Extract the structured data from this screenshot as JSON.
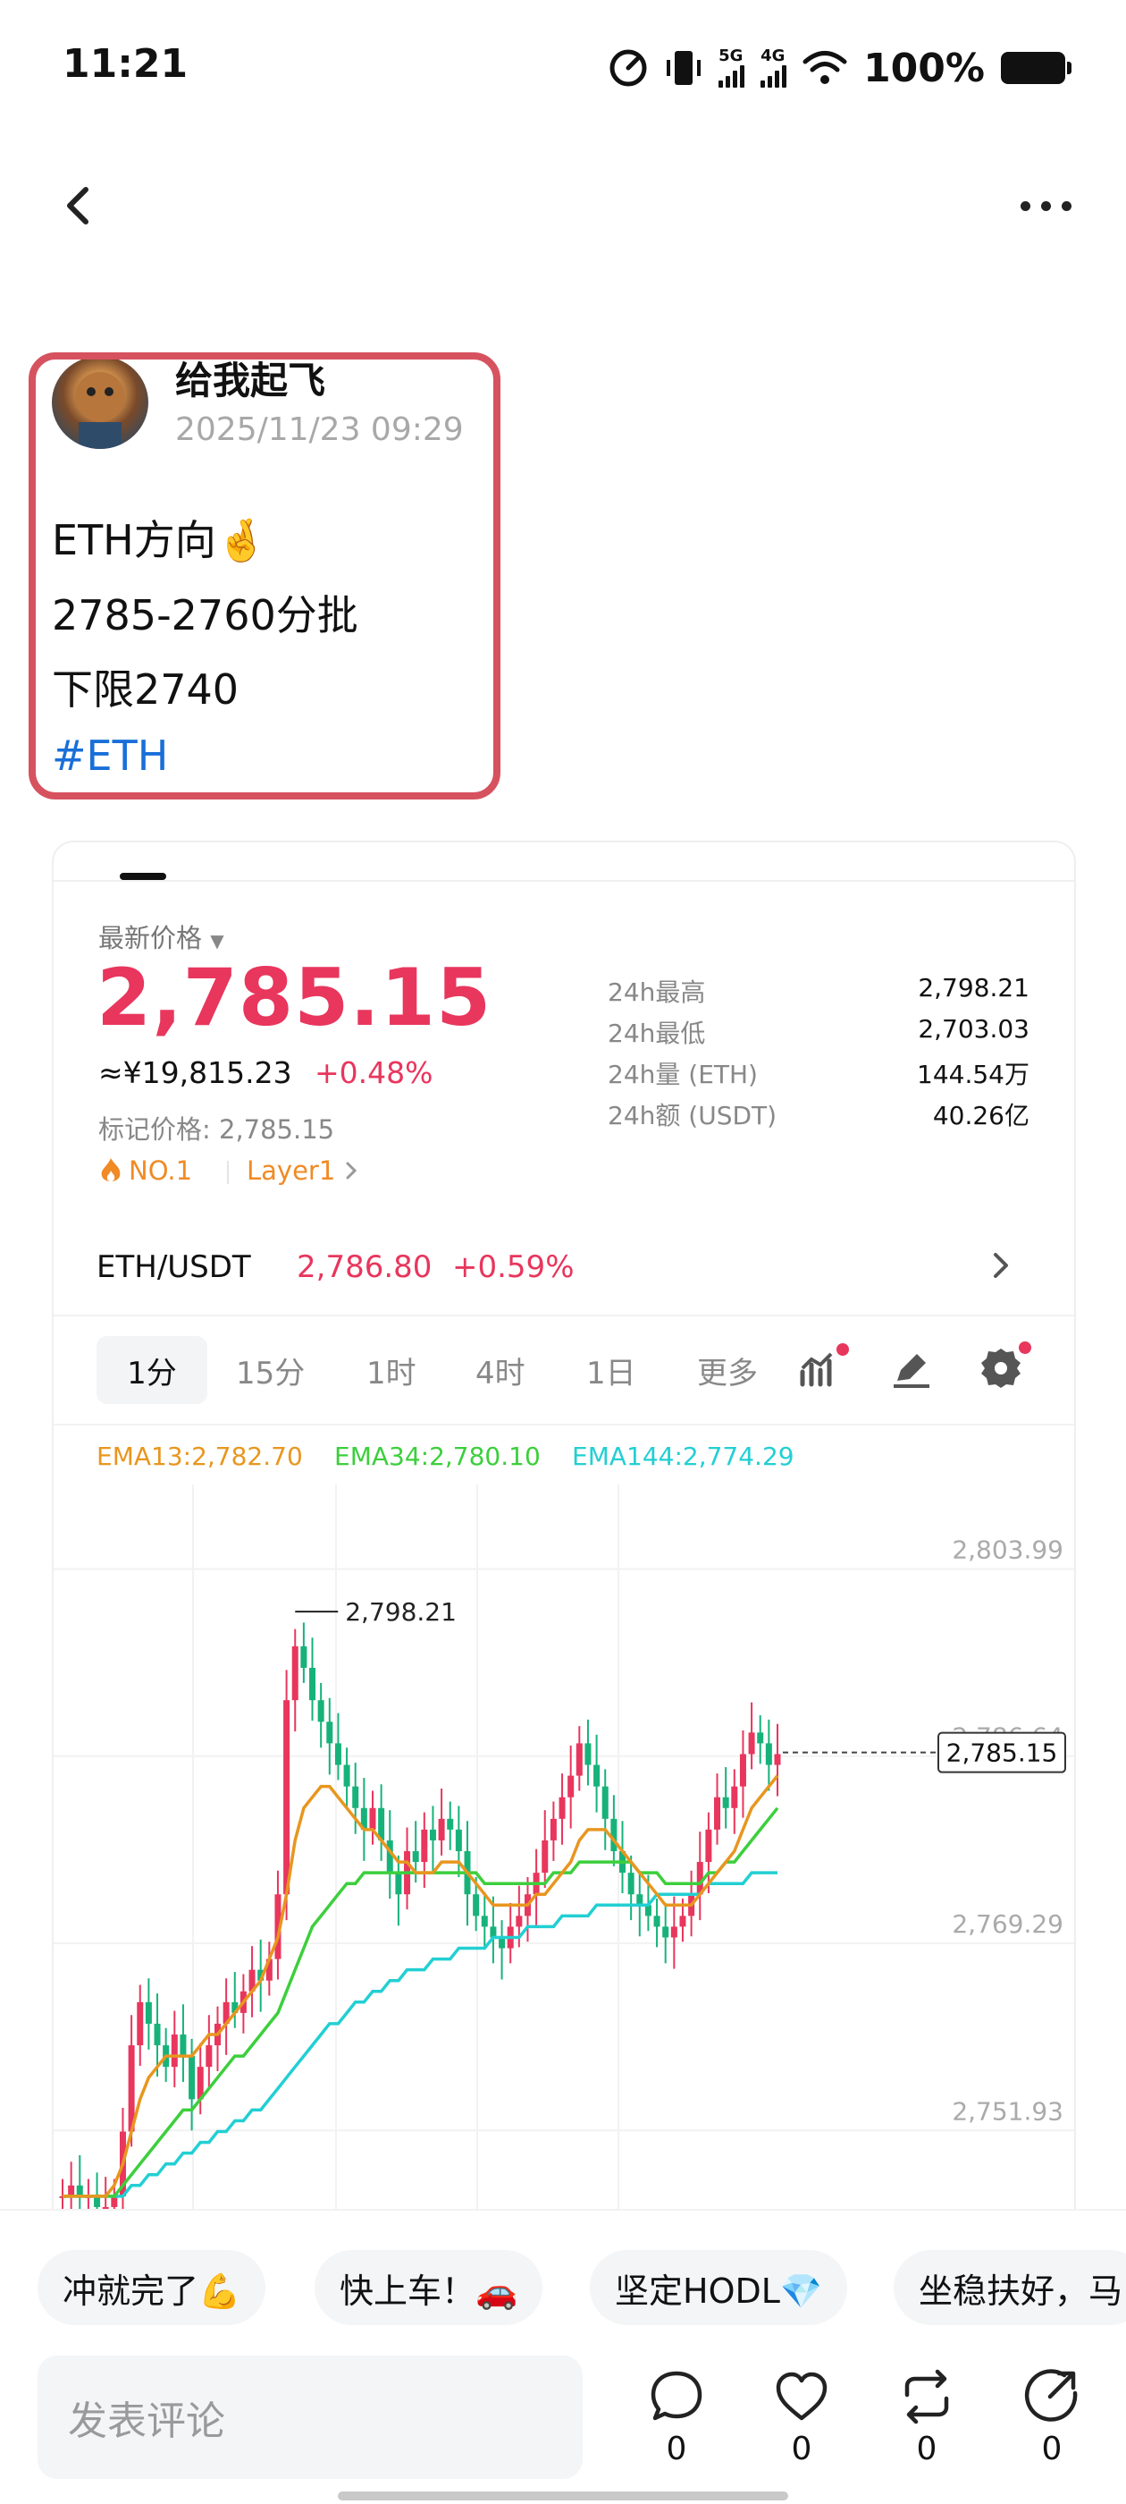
{
  "status_bar": {
    "time": "11:21",
    "network_5g": "5G",
    "network_4g": "4G",
    "battery": "100%"
  },
  "header": {
    "back_icon": "chevron-left-icon",
    "more_icon": "more-horizontal-icon"
  },
  "post": {
    "author": "给我起飞",
    "time": "2025/11/23 09:29",
    "line1": "ETH方向🤞",
    "line2": "2785-2760分批",
    "line3": "下限2740",
    "tag": "#ETH",
    "highlight_color": "#d6525f"
  },
  "market": {
    "latest_label": "最新价格",
    "price": "2,785.15",
    "cny_price": "≈¥19,815.23",
    "change": "+0.48%",
    "mark_price": "标记价格: 2,785.15",
    "rank": "NO.1",
    "layer": "Layer1",
    "stats": [
      {
        "label": "24h最高",
        "value": "2,798.21"
      },
      {
        "label": "24h最低",
        "value": "2,703.03"
      },
      {
        "label": "24h量 (ETH)",
        "value": "144.54万"
      },
      {
        "label": "24h额 (USDT)",
        "value": "40.26亿"
      }
    ],
    "pair": {
      "name": "ETH/USDT",
      "price": "2,786.80",
      "change": "+0.59%"
    },
    "intervals": [
      "1分",
      "15分",
      "1时",
      "4时",
      "1日",
      "更多"
    ],
    "active_interval": "1分",
    "accent_up": "#e8365d",
    "accent_orange": "#f08a24"
  },
  "chart_data": {
    "type": "candlestick",
    "title": "",
    "ema": [
      {
        "name": "EMA13",
        "label": "EMA13:2,782.70",
        "color": "#e8961f"
      },
      {
        "name": "EMA34",
        "label": "EMA34:2,780.10",
        "color": "#3ccf3c"
      },
      {
        "name": "EMA144",
        "label": "EMA144:2,774.29",
        "color": "#22cfd3"
      }
    ],
    "y_ticks": [
      "2,803.99",
      "2,786.64",
      "2,769.29",
      "2,751.93"
    ],
    "y_tick_values": [
      2803.99,
      2786.64,
      2769.29,
      2751.93
    ],
    "ylim": [
      2742,
      2810
    ],
    "high_marker": "2,798.21",
    "high_value": 2798.21,
    "last_price_label": "2,785.15",
    "last_price": 2785.15,
    "close_series": [
      2744,
      2745,
      2744,
      2744,
      2743,
      2743,
      2744,
      2750,
      2758,
      2762,
      2760,
      2758,
      2756,
      2759,
      2757,
      2753,
      2756,
      2758,
      2760,
      2762,
      2761,
      2763,
      2765,
      2764,
      2766,
      2772,
      2790,
      2795,
      2793,
      2790,
      2788,
      2786,
      2784,
      2782,
      2780,
      2778,
      2780,
      2777,
      2774,
      2772,
      2776,
      2775,
      2778,
      2777,
      2779,
      2778,
      2776,
      2772,
      2770,
      2769,
      2768,
      2767,
      2769,
      2770,
      2772,
      2774,
      2777,
      2779,
      2781,
      2783,
      2786,
      2784,
      2782,
      2779,
      2776,
      2774,
      2772,
      2771,
      2770,
      2769,
      2768,
      2769,
      2770,
      2772,
      2775,
      2778,
      2781,
      2780,
      2782,
      2785,
      2787,
      2786,
      2784,
      2785
    ],
    "ema13": [
      2744,
      2744,
      2744,
      2744,
      2744,
      2744,
      2745,
      2747,
      2750,
      2753,
      2755,
      2756,
      2757,
      2757,
      2757,
      2757,
      2758,
      2759,
      2759,
      2760,
      2761,
      2762,
      2763,
      2764,
      2766,
      2768,
      2772,
      2777,
      2780,
      2781,
      2782,
      2782,
      2781,
      2780,
      2779,
      2778,
      2778,
      2777,
      2776,
      2775,
      2775,
      2774,
      2774,
      2774,
      2775,
      2775,
      2775,
      2774,
      2773,
      2772,
      2771,
      2771,
      2771,
      2771,
      2771,
      2772,
      2772,
      2773,
      2774,
      2775,
      2777,
      2778,
      2778,
      2778,
      2777,
      2776,
      2775,
      2774,
      2773,
      2772,
      2771,
      2771,
      2771,
      2771,
      2772,
      2773,
      2774,
      2775,
      2776,
      2778,
      2780,
      2781,
      2782,
      2783
    ],
    "ema34": [
      2744,
      2744,
      2744,
      2744,
      2744,
      2744,
      2744,
      2745,
      2746,
      2747,
      2748,
      2749,
      2750,
      2751,
      2752,
      2752,
      2753,
      2754,
      2755,
      2756,
      2757,
      2757,
      2758,
      2759,
      2760,
      2761,
      2763,
      2765,
      2767,
      2769,
      2770,
      2771,
      2772,
      2773,
      2773,
      2774,
      2774,
      2774,
      2774,
      2774,
      2774,
      2774,
      2774,
      2774,
      2774,
      2774,
      2774,
      2774,
      2774,
      2773,
      2773,
      2773,
      2773,
      2773,
      2773,
      2773,
      2773,
      2774,
      2774,
      2774,
      2775,
      2775,
      2775,
      2775,
      2775,
      2775,
      2775,
      2774,
      2774,
      2774,
      2773,
      2773,
      2773,
      2773,
      2773,
      2774,
      2774,
      2775,
      2775,
      2776,
      2777,
      2778,
      2779,
      2780
    ],
    "ema144": [
      2744,
      2744,
      2744,
      2744,
      2744,
      2744,
      2744,
      2744,
      2745,
      2745,
      2746,
      2746,
      2747,
      2747,
      2748,
      2748,
      2749,
      2749,
      2750,
      2750,
      2751,
      2751,
      2752,
      2752,
      2753,
      2754,
      2755,
      2756,
      2757,
      2758,
      2759,
      2760,
      2760,
      2761,
      2762,
      2762,
      2763,
      2763,
      2764,
      2764,
      2765,
      2765,
      2765,
      2766,
      2766,
      2766,
      2767,
      2767,
      2767,
      2767,
      2768,
      2768,
      2768,
      2768,
      2769,
      2769,
      2769,
      2769,
      2770,
      2770,
      2770,
      2770,
      2771,
      2771,
      2771,
      2771,
      2771,
      2771,
      2771,
      2772,
      2772,
      2772,
      2772,
      2772,
      2772,
      2773,
      2773,
      2773,
      2773,
      2773,
      2774,
      2774,
      2774,
      2774
    ]
  },
  "quick_replies": [
    "冲就完了💪",
    "快上车！🚗",
    "坚定HODL💎",
    "坐稳扶好，马"
  ],
  "comment": {
    "placeholder": "发表评论",
    "actions": [
      {
        "icon": "comment-icon",
        "count": "0"
      },
      {
        "icon": "heart-icon",
        "count": "0"
      },
      {
        "icon": "repost-icon",
        "count": "0"
      },
      {
        "icon": "share-icon",
        "count": "0"
      }
    ]
  }
}
